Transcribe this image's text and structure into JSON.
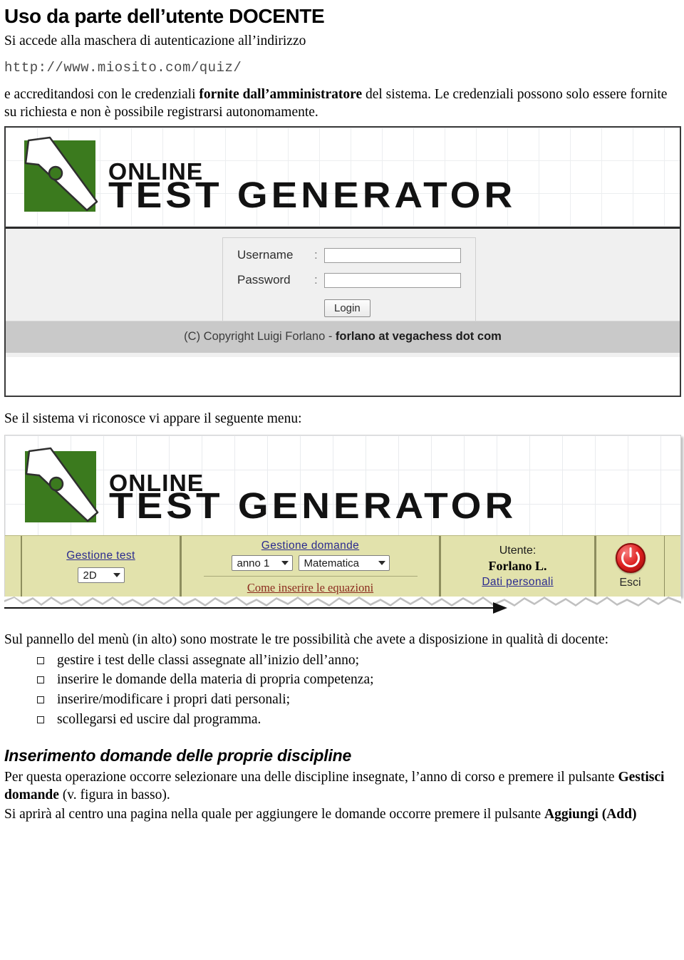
{
  "document": {
    "heading_main": "Uso da parte dell’utente DOCENTE",
    "intro_line": "Si accede alla maschera di autenticazione all’indirizzo",
    "url": "http://www.miosito.com/quiz/",
    "para_credentials_pre": "e accreditandosi con le credenziali ",
    "para_credentials_bold": "fornite dall’amministratore",
    "para_credentials_post": " del sistema. Le credenziali possono solo essere fornite su richiesta e non è possibile registrarsi autonomamente.",
    "caption_menu": "Se il sistema vi riconosce vi appare il seguente menu:",
    "para_panel": "Sul pannello del menù (in alto) sono mostrate le tre possibilità che avete a disposizione in qualità di docente:",
    "bullets": [
      "gestire i test delle classi assegnate all’inizio dell’anno;",
      "inserire le domande della materia di propria competenza;",
      "inserire/modificare i propri dati personali;",
      "scollegarsi ed uscire dal programma."
    ],
    "heading_section2": "Inserimento domande delle proprie discipline",
    "para_section2_a_pre": "Per questa operazione occorre selezionare una delle discipline insegnate, l’anno di corso e premere il pulsante ",
    "para_section2_a_bold": "Gestisci domande",
    "para_section2_a_post": " (v. figura in basso).",
    "para_section2_b_pre": "Si aprirà al centro una pagina nella quale per aggiungere le domande occorre premere il pulsante ",
    "para_section2_b_bold": "Aggiungi (Add)"
  },
  "login_screenshot": {
    "brand_line1": "ONLINE",
    "brand_line2": "TEST GENERATOR",
    "username_label": "Username",
    "password_label": "Password",
    "colon": ":",
    "username_value": "",
    "password_value": "",
    "login_button": "Login",
    "copyright_plain": "(C) Copyright Luigi Forlano - ",
    "copyright_bold": "forlano at vegachess dot com",
    "logo_color": "#3b7a1e"
  },
  "menu_screenshot": {
    "brand_line1": "ONLINE",
    "brand_line2": "TEST GENERATOR",
    "toolbar": {
      "bg_color": "#e2e2ac",
      "test_link": "Gestione test",
      "test_select_value": "2D",
      "domande_link": "Gestione domande",
      "anno_select_value": "anno 1",
      "materia_select_value": "Matematica",
      "equazioni_link": "Come inserire le equazioni",
      "utente_label": "Utente:",
      "utente_name": "Forlano L.",
      "dati_personali_link": "Dati personali",
      "esci_label": "Esci",
      "esci_icon": "power-icon",
      "link_color": "#2b2b8f",
      "equazioni_color": "#8b2b1e",
      "power_color": "#dd1f1f"
    }
  }
}
